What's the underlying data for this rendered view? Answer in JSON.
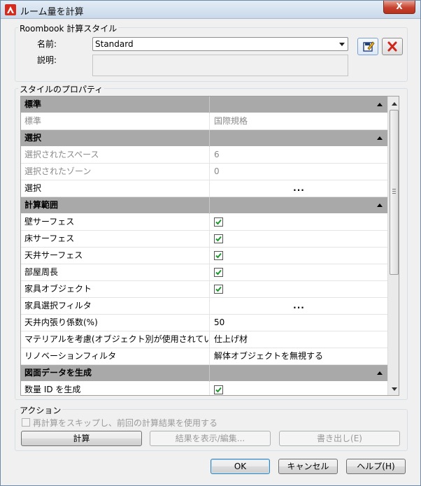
{
  "window": {
    "title": "ルーム量を計算",
    "close_label": "X"
  },
  "style_group": {
    "label": "Roombook 計算スタイル",
    "name_label": "名前:",
    "name_value": "Standard",
    "desc_label": "説明:",
    "desc_value": ""
  },
  "props_group": {
    "label": "スタイルのプロパティ"
  },
  "grid": {
    "rows": [
      {
        "type": "cat",
        "name": "標準"
      },
      {
        "type": "dis",
        "name": "標準",
        "value": "国際規格"
      },
      {
        "type": "cat",
        "name": "選択"
      },
      {
        "type": "dis",
        "name": "選択されたスペース",
        "value": "6"
      },
      {
        "type": "dis",
        "name": "選択されたゾーン",
        "value": "0"
      },
      {
        "type": "btn",
        "name": "選択",
        "value": "..."
      },
      {
        "type": "cat",
        "name": "計算範囲"
      },
      {
        "type": "chk",
        "name": "壁サーフェス",
        "checked": true
      },
      {
        "type": "chk",
        "name": "床サーフェス",
        "checked": true
      },
      {
        "type": "chk",
        "name": "天井サーフェス",
        "checked": true
      },
      {
        "type": "chk",
        "name": "部屋周長",
        "checked": true
      },
      {
        "type": "chk",
        "name": "家具オブジェクト",
        "checked": true
      },
      {
        "type": "btn",
        "name": "家具選択フィルタ",
        "value": "..."
      },
      {
        "type": "text",
        "name": "天井内張り係数(%)",
        "value": "50"
      },
      {
        "type": "text",
        "name": "マテリアルを考慮(オブジェクト別が使用されてい",
        "value": "仕上げ材"
      },
      {
        "type": "text",
        "name": "リノベーションフィルタ",
        "value": "解体オブジェクトを無視する"
      },
      {
        "type": "cat",
        "name": "図面データを生成"
      },
      {
        "type": "chk",
        "name": "数量 ID を生成",
        "checked": true
      }
    ]
  },
  "actions_group": {
    "label": "アクション",
    "skip_checkbox_label": "再計算をスキップし、前回の計算結果を使用する",
    "calculate_label": "計算",
    "show_results_label": "結果を表示/編集...",
    "export_label": "書き出し(E)"
  },
  "footer": {
    "ok_label": "OK",
    "cancel_label": "キャンセル",
    "help_label": "ヘルプ(H)"
  },
  "colors": {
    "category_bg": "#a9a9a9",
    "check_green": "#1a9a2a",
    "delete_red": "#d0251a"
  },
  "icons": {
    "app": "autocad-a-icon",
    "edit_style": "edit-style-icon",
    "delete_style": "delete-x-icon"
  }
}
